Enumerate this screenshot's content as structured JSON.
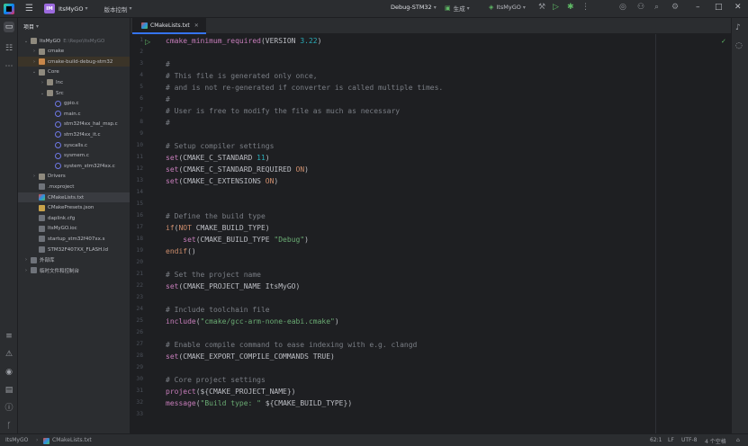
{
  "titlebar": {
    "project_badge": "IM",
    "project_name": "ItsMyGO",
    "vcs_label": "版本控制",
    "config_label": "Debug-STM32",
    "generate_label": "生成",
    "target_label": "ItsMyGO"
  },
  "project_panel": {
    "title": "项目",
    "items": [
      {
        "label": "ItsMyGO",
        "hint": "E:\\Repo\\ItsMyGO",
        "indent": 0,
        "arrow": "v",
        "icon": "folder"
      },
      {
        "label": "cmake",
        "indent": 1,
        "arrow": ">",
        "icon": "folder"
      },
      {
        "label": "cmake-build-debug-stm32",
        "indent": 1,
        "arrow": ">",
        "icon": "folder-orange",
        "state": "hl"
      },
      {
        "label": "Core",
        "indent": 1,
        "arrow": "v",
        "icon": "folder"
      },
      {
        "label": "Inc",
        "indent": 2,
        "arrow": ">",
        "icon": "folder"
      },
      {
        "label": "Src",
        "indent": 2,
        "arrow": "v",
        "icon": "folder"
      },
      {
        "label": "gpio.c",
        "indent": 3,
        "arrow": "",
        "icon": "c"
      },
      {
        "label": "main.c",
        "indent": 3,
        "arrow": "",
        "icon": "c"
      },
      {
        "label": "stm32f4xx_hal_msp.c",
        "indent": 3,
        "arrow": "",
        "icon": "c"
      },
      {
        "label": "stm32f4xx_it.c",
        "indent": 3,
        "arrow": "",
        "icon": "c"
      },
      {
        "label": "syscalls.c",
        "indent": 3,
        "arrow": "",
        "icon": "c"
      },
      {
        "label": "sysmem.c",
        "indent": 3,
        "arrow": "",
        "icon": "c"
      },
      {
        "label": "system_stm32f4xx.c",
        "indent": 3,
        "arrow": "",
        "icon": "c"
      },
      {
        "label": "Drivers",
        "indent": 1,
        "arrow": ">",
        "icon": "folder"
      },
      {
        "label": ".mxproject",
        "indent": 1,
        "arrow": "",
        "icon": "generic"
      },
      {
        "label": "CMakeLists.txt",
        "indent": 1,
        "arrow": "",
        "icon": "cmake",
        "state": "selected"
      },
      {
        "label": "CMakePresets.json",
        "indent": 1,
        "arrow": "",
        "icon": "json"
      },
      {
        "label": "daplink.cfg",
        "indent": 1,
        "arrow": "",
        "icon": "generic"
      },
      {
        "label": "ItsMyGO.ioc",
        "indent": 1,
        "arrow": "",
        "icon": "generic"
      },
      {
        "label": "startup_stm32f407xx.s",
        "indent": 1,
        "arrow": "",
        "icon": "generic"
      },
      {
        "label": "STM32F407XX_FLASH.ld",
        "indent": 1,
        "arrow": "",
        "icon": "generic"
      },
      {
        "label": "外部库",
        "indent": 0,
        "arrow": ">",
        "icon": "generic"
      },
      {
        "label": "临时文件和控制台",
        "indent": 0,
        "arrow": ">",
        "icon": "generic"
      }
    ]
  },
  "editor": {
    "tab_label": "CMakeLists.txt",
    "lines": [
      [
        [
          "f",
          "cmake_minimum_required"
        ],
        [
          "p",
          "(VERSION "
        ],
        [
          "n",
          "3.22"
        ],
        [
          "p",
          ")"
        ]
      ],
      [],
      [
        [
          "c",
          "#"
        ]
      ],
      [
        [
          "c",
          "# This file is generated only once,"
        ]
      ],
      [
        [
          "c",
          "# and is not re-generated if converter is called multiple times."
        ]
      ],
      [
        [
          "c",
          "#"
        ]
      ],
      [
        [
          "c",
          "# User is free to modify the file as much as necessary"
        ]
      ],
      [
        [
          "c",
          "#"
        ]
      ],
      [],
      [
        [
          "c",
          "# Setup compiler settings"
        ]
      ],
      [
        [
          "f",
          "set"
        ],
        [
          "p",
          "(CMAKE_C_STANDARD "
        ],
        [
          "n",
          "11"
        ],
        [
          "p",
          ")"
        ]
      ],
      [
        [
          "f",
          "set"
        ],
        [
          "p",
          "(CMAKE_C_STANDARD_REQUIRED "
        ],
        [
          "k",
          "ON"
        ],
        [
          "p",
          ")"
        ]
      ],
      [
        [
          "f",
          "set"
        ],
        [
          "p",
          "(CMAKE_C_EXTENSIONS "
        ],
        [
          "k",
          "ON"
        ],
        [
          "p",
          ")"
        ]
      ],
      [],
      [],
      [
        [
          "c",
          "# Define the build type"
        ]
      ],
      [
        [
          "k",
          "if"
        ],
        [
          "p",
          "("
        ],
        [
          "k",
          "NOT"
        ],
        [
          "p",
          " CMAKE_BUILD_TYPE)"
        ]
      ],
      [
        [
          "p",
          "    "
        ],
        [
          "f",
          "set"
        ],
        [
          "p",
          "(CMAKE_BUILD_TYPE "
        ],
        [
          "s",
          "\"Debug\""
        ],
        [
          "p",
          ")"
        ]
      ],
      [
        [
          "k",
          "endif"
        ],
        [
          "p",
          "()"
        ]
      ],
      [],
      [
        [
          "c",
          "# Set the project name"
        ]
      ],
      [
        [
          "f",
          "set"
        ],
        [
          "p",
          "(CMAKE_PROJECT_NAME ItsMyGO)"
        ]
      ],
      [],
      [
        [
          "c",
          "# Include toolchain file"
        ]
      ],
      [
        [
          "f",
          "include"
        ],
        [
          "p",
          "("
        ],
        [
          "s",
          "\"cmake/gcc-arm-none-eabi.cmake\""
        ],
        [
          "p",
          ")"
        ]
      ],
      [],
      [
        [
          "c",
          "# Enable compile command to ease indexing with e.g. clangd"
        ]
      ],
      [
        [
          "f",
          "set"
        ],
        [
          "p",
          "(CMAKE_EXPORT_COMPILE_COMMANDS TRUE)"
        ]
      ],
      [],
      [
        [
          "c",
          "# Core project settings"
        ]
      ],
      [
        [
          "f",
          "project"
        ],
        [
          "p",
          "(${CMAKE_PROJECT_NAME})"
        ]
      ],
      [
        [
          "f",
          "message"
        ],
        [
          "p",
          "("
        ],
        [
          "s",
          "\"Build type: \""
        ],
        [
          "p",
          " ${CMAKE_BUILD_TYPE})"
        ]
      ],
      []
    ]
  },
  "statusbar": {
    "project": "ItsMyGO",
    "file": "CMakeLists.txt",
    "position": "62:1",
    "line_sep": "LF",
    "encoding": "UTF-8",
    "indent": "4 个空格"
  }
}
